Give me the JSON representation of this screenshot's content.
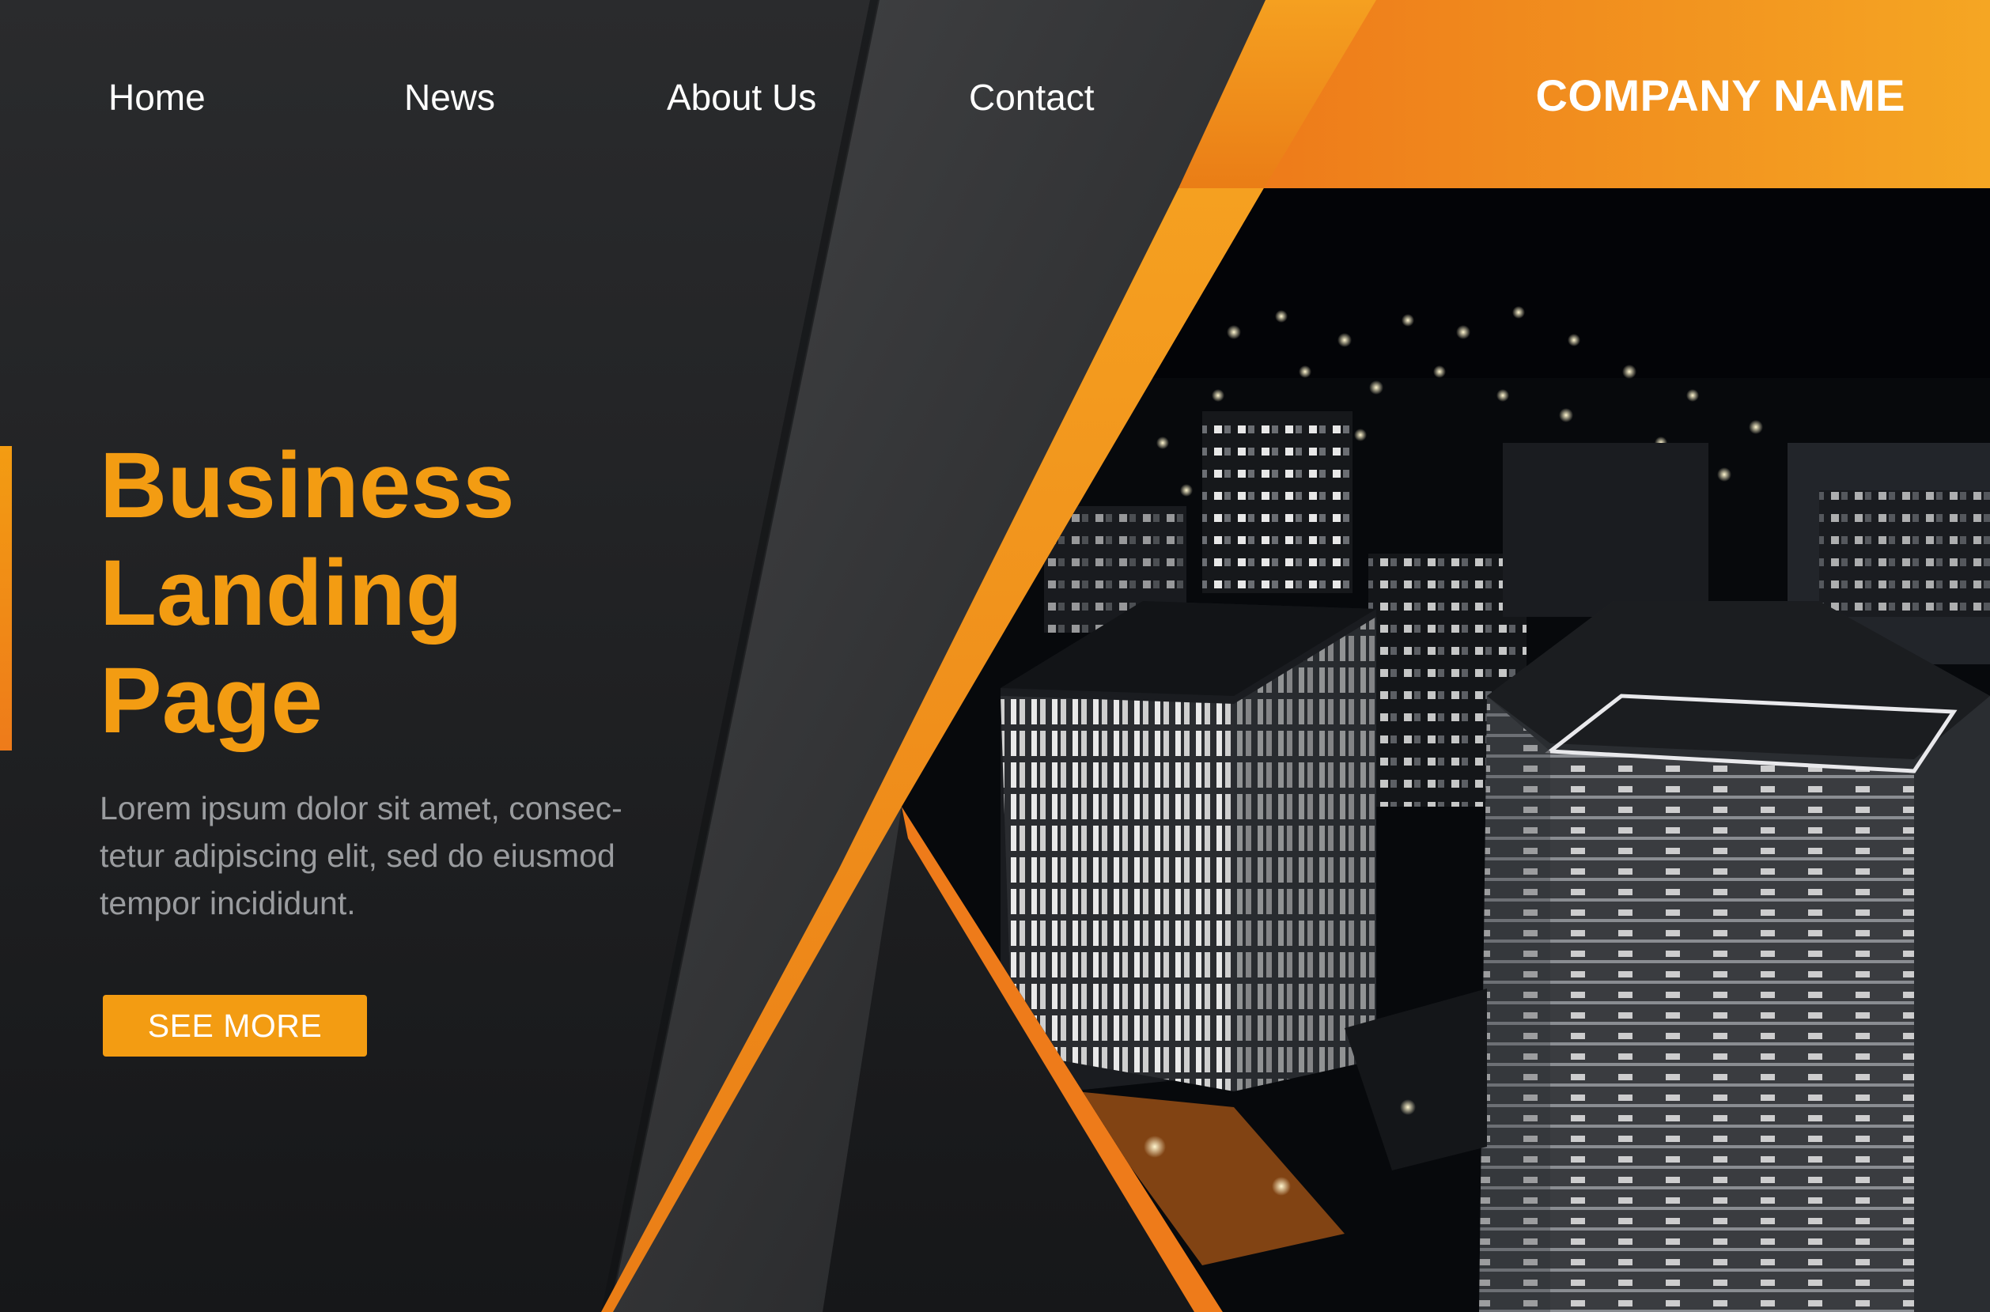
{
  "nav": {
    "items": [
      {
        "label": "Home"
      },
      {
        "label": "News"
      },
      {
        "label": "About Us"
      },
      {
        "label": "Contact"
      }
    ]
  },
  "brand": {
    "name": "COMPANY NAME"
  },
  "hero": {
    "title_lines": [
      "Business",
      "Landing",
      "Page"
    ],
    "description": "Lorem ipsum dolor sit amet, consec-tetur adipiscing elit, sed do eiusmod tempor incididunt.",
    "cta_label": "SEE MORE",
    "image": "night-city-skyscrapers-aerial-photo"
  },
  "colors": {
    "accent": "#f39c12",
    "accent_dark": "#ee7b1a",
    "panel_dark": "#1c1d1f",
    "panel_mid": "#3a3b3d",
    "text_light": "#ffffff",
    "text_muted": "#9a9c9f"
  }
}
